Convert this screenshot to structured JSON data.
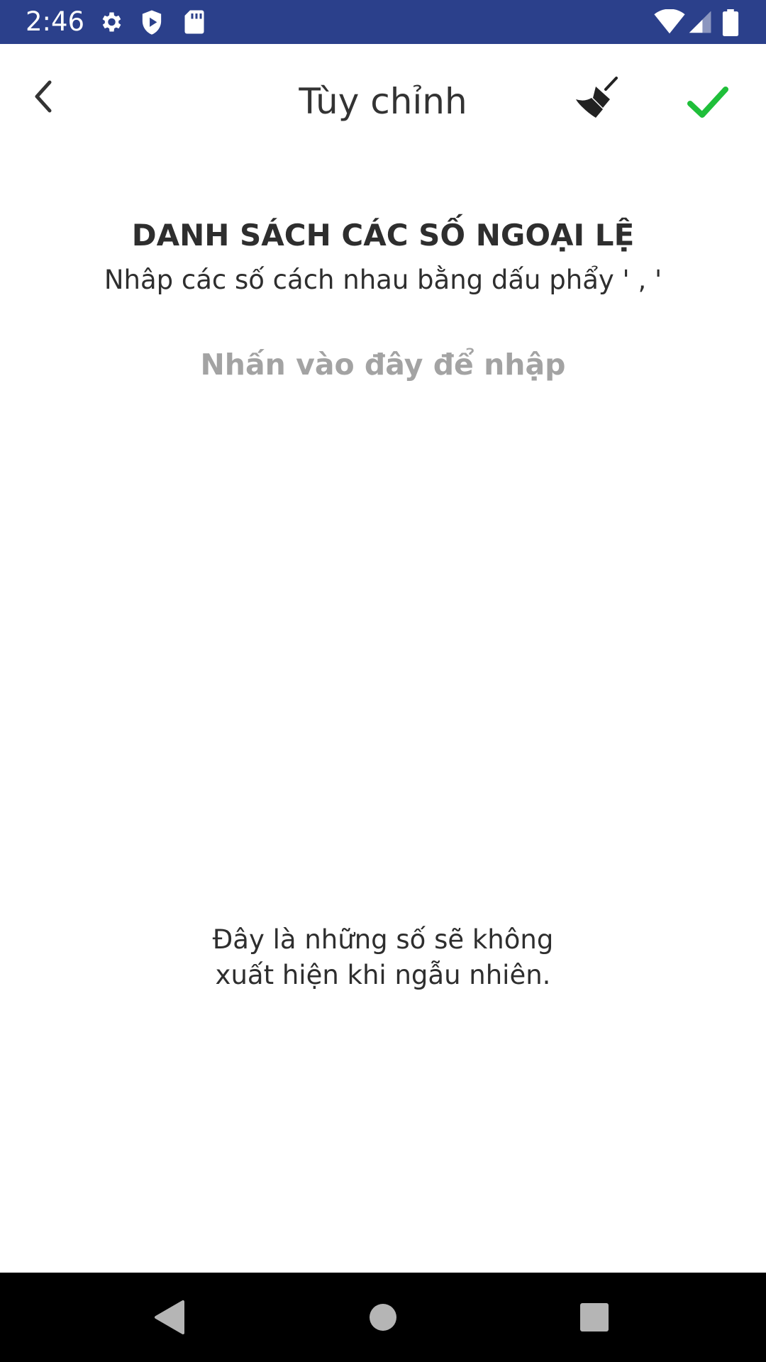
{
  "status_bar": {
    "time": "2:46",
    "icons": [
      "settings-icon",
      "shield-play-icon",
      "sd-card-icon",
      "wifi-icon",
      "signal-icon",
      "battery-icon"
    ],
    "background": "#2b408b"
  },
  "app_bar": {
    "title": "Tùy chỉnh",
    "back_icon": "chevron-left-icon",
    "clear_icon": "broom-icon",
    "confirm_icon": "check-icon",
    "confirm_color": "#1fbf3a"
  },
  "content": {
    "heading": "DANH SÁCH CÁC SỐ NGOẠI LỆ",
    "hint": "Nhâp các số cách nhau bằng dấu phẩy  ' , '",
    "input_placeholder": "Nhấn vào đây để nhập",
    "note_line1": "Đây là những số sẽ không",
    "note_line2": "xuất hiện khi ngẫu nhiên."
  },
  "nav_bar": {
    "icons": [
      "back-triangle-icon",
      "home-circle-icon",
      "recents-square-icon"
    ]
  }
}
